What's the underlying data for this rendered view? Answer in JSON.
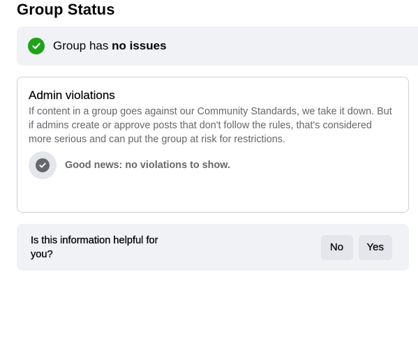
{
  "page": {
    "title": "Group Status"
  },
  "status": {
    "prefix": "Group has ",
    "emphasis": "no issues",
    "icon": "green-check-circle-icon",
    "color": "#1fa318"
  },
  "admin_violations": {
    "title": "Admin violations",
    "description": "If content in a group goes against our Community Standards, we take it down. But if admins create or approve posts that don't follow the rules, that's considered more serious and can put the group at risk for restrictions.",
    "good_news": "Good news: no violations to show.",
    "icon": "grey-check-circle-icon"
  },
  "feedback": {
    "question": "Is this information helpful for you?",
    "no_label": "No",
    "yes_label": "Yes"
  }
}
